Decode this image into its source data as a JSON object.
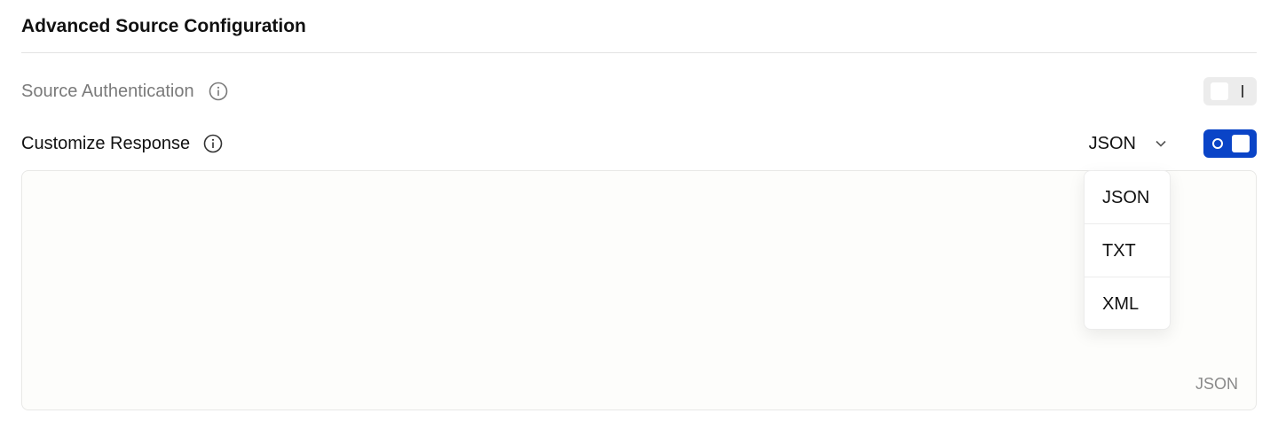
{
  "section": {
    "title": "Advanced Source Configuration"
  },
  "source_authentication": {
    "label": "Source Authentication",
    "info_icon": "info-icon",
    "toggle_state": "off"
  },
  "customize_response": {
    "label": "Customize Response",
    "info_icon": "info-icon",
    "format": {
      "selected": "JSON",
      "icon": "chevron-down-icon"
    },
    "toggle_state": "on"
  },
  "editor": {
    "language_label": "JSON"
  },
  "dropdown": {
    "options": [
      {
        "label": "JSON"
      },
      {
        "label": "TXT"
      },
      {
        "label": "XML"
      }
    ]
  },
  "colors": {
    "accent": "#0a44c7",
    "toggle_off_bg": "#ececec",
    "muted_text": "#7a7a7a",
    "divider": "#e3e3e3"
  }
}
